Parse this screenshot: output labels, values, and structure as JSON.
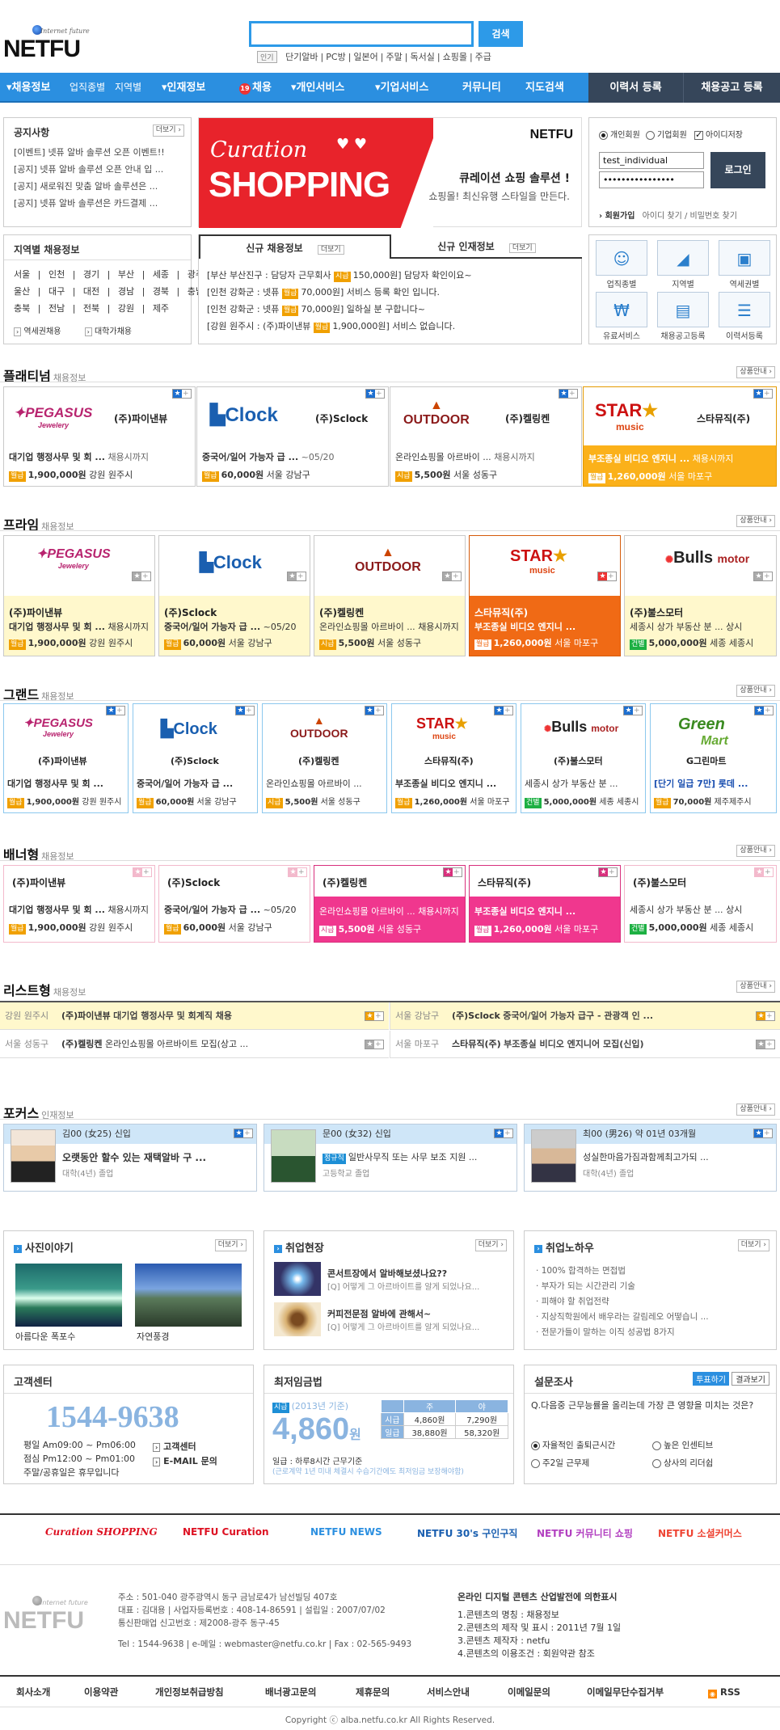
{
  "header": {
    "logo_text": "NETFU",
    "logo_tag": "Internet future",
    "search_button": "검색",
    "quick_badge": "인기",
    "quick_links": [
      "단기알바",
      "PC방",
      "일본어",
      "주말",
      "독서실",
      "쇼핑몰",
      "주급"
    ]
  },
  "nav": {
    "items": [
      "채용정보",
      "업직종별",
      "지역별",
      "인재정보",
      "채용",
      "개인서비스",
      "기업서비스",
      "커뮤니티",
      "지도검색"
    ],
    "resume_btn": "이력서 등록",
    "job_btn": "채용공고 등록"
  },
  "notice": {
    "title": "공지사항",
    "more": "더보기",
    "items": [
      "[이벤트] 넷퓨 알바 솔루션 오픈 이벤트!!",
      "[공지] 넷퓨 알바 솔루션 오픈 안내 입 ...",
      "[공지] 새로워진 맞춤 알바 솔루션은 ...",
      "[공지] 넷퓨 알바 솔루션은 카드결제 ..."
    ]
  },
  "banner": {
    "curation": "Curation",
    "shopping": "SHOPPING",
    "logo": "NETFU",
    "headline": "큐레이션 쇼핑 솔루션 !",
    "sub": "쇼핑몰! 최신유행 스타일을 만든다."
  },
  "login": {
    "personal": "개인회원",
    "company": "기업회원",
    "save_id": "아이디저장",
    "user_id": "test_individual",
    "password": "••••••••••••••••",
    "login_btn": "로그인",
    "join": "회원가입",
    "find": "아이디 찾기 / 비밀번호 찾기"
  },
  "region": {
    "title": "지역별 채용정보",
    "rows": [
      [
        "서울",
        "인천",
        "경기",
        "부산",
        "세종",
        "광주"
      ],
      [
        "울산",
        "대구",
        "대전",
        "경남",
        "경북",
        "충남"
      ],
      [
        "충북",
        "전남",
        "전북",
        "강원",
        "제주"
      ]
    ],
    "station": "역세권채용",
    "univ": "대학가채용"
  },
  "recent": {
    "tab1": "신규 채용정보",
    "tab2": "신규 인재정보",
    "more": "더보기",
    "items": [
      [
        "[부산 부산진구 : 담당자 근무회사",
        "시급",
        "150,000원",
        "] 담당자 확인이요~"
      ],
      [
        "[인천 강화군 : 넷퓨",
        "월급",
        "70,000원",
        "] 서비스 등록 확인 입니다."
      ],
      [
        "[인천 강화군 : 넷퓨",
        "월급",
        "70,000원",
        "] 일하실 분 구합니다~"
      ],
      [
        "[강원 원주시 : (주)파이낸뷰",
        "월급",
        "1,900,000원",
        "] 서비스 없습니다."
      ]
    ]
  },
  "quicklinks": [
    {
      "label": "업직종별",
      "icon": "person-icon"
    },
    {
      "label": "지역별",
      "icon": "map-icon"
    },
    {
      "label": "역세권별",
      "icon": "bus-icon"
    },
    {
      "label": "유료서비스",
      "icon": "won-icon"
    },
    {
      "label": "채용공고등록",
      "icon": "document-icon"
    },
    {
      "label": "이력서등록",
      "icon": "resume-icon"
    }
  ],
  "sections": {
    "platinum": "플래티넘",
    "prime": "프라임",
    "grand": "그랜드",
    "banner": "배너형",
    "list": "리스트형",
    "focus": "포커스",
    "suffix_job": "채용정보",
    "suffix_talent": "인재정보",
    "guide": "상품안내"
  },
  "companies": {
    "pegasus": {
      "logo": "PEGASUS",
      "logo_sub": "Jewelery",
      "name": "(주)파이낸뷰",
      "title": "대기업 행정사무 및 회 ...",
      "deadline": "채용시까지",
      "wage_type": "월급",
      "wage": "1,900,000원",
      "loc": "강원 원주시"
    },
    "clock": {
      "logo": "Clock",
      "logo_sub": "outdoor wear",
      "name": "(주)Sclock",
      "title": "중국어/일어 가능자 급 ...",
      "deadline": "~05/20",
      "wage_type": "월급",
      "wage": "60,000원",
      "loc": "서울 강남구"
    },
    "outdoor": {
      "logo": "OUTDOOR",
      "logo_sub": "outdoor sport",
      "name": "(주)켈링켄",
      "title": "온라인쇼핑몰 아르바이 ...",
      "deadline": "채용시까지",
      "wage_type": "시급",
      "wage": "5,500원",
      "loc": "서울 성동구"
    },
    "star": {
      "logo": "STAR",
      "logo_sub": "music",
      "name": "스타뮤직(주)",
      "title": "부조종실 비디오 엔지니 ...",
      "deadline": "채용시까지",
      "wage_type": "월급",
      "wage": "1,260,000원",
      "loc": "서울 마포구"
    },
    "bulls": {
      "logo": "Bulls",
      "logo_sub": "motor",
      "name": "(주)불스모터",
      "title": "세종시 상가 부동산 분 ...",
      "deadline": "상시",
      "wage_type": "건별",
      "wage": "5,000,000원",
      "loc": "세종 세종시"
    },
    "green": {
      "logo": "Green",
      "logo_sub": "Mart",
      "name": "G그린마트",
      "title": "[단기 일급 7만] 롯데 ...",
      "wage_type": "월급",
      "wage": "70,000원",
      "loc": "제주제주시"
    }
  },
  "listrows": [
    {
      "loc": "강원 원주시",
      "name": "(주)파이낸뷰",
      "title": "대기업 행정사무 및 회계직 채용"
    },
    {
      "loc": "서울 강남구",
      "name": "(주)Sclock",
      "title": "중국어/일어 가능자 급구 - 관광객 인 ..."
    },
    {
      "loc": "서울 성동구",
      "name": "(주)켈링켄",
      "title": "온라인쇼핑몰 아르바이트 모집(상고 ..."
    },
    {
      "loc": "서울 마포구",
      "name": "스타뮤직(주)",
      "title": "부조종실 비디오 엔지니어 모집(신입)"
    }
  ],
  "focus": [
    {
      "head": "김00 (女25) 신입",
      "title": "오랫동안 할수 있는 재택알바 구 ...",
      "edu": "대학(4년) 졸업"
    },
    {
      "head": "문00 (女32) 신입",
      "badge": "정규직",
      "title": "일반사무직 또는 사무 보조 지원 ...",
      "edu": "고등학교 졸업"
    },
    {
      "head": "최00 (男26) 약 01년 03개월",
      "title": "성실한마음가짐과함께최고가되 ...",
      "edu": "대학(4년) 졸업"
    }
  ],
  "photo": {
    "title": "사진이야기",
    "more": "더보기",
    "items": [
      "아름다운 폭포수",
      "자연풍경"
    ]
  },
  "field": {
    "title": "취업현장",
    "more": "더보기",
    "items": [
      {
        "t": "콘서트장에서 알바해보셨나요??",
        "s": "[Q] 어떻게 그 아르바이트를 알게 되었나요..."
      },
      {
        "t": "커피전문점 알바에 관해서~",
        "s": "[Q] 어떻게 그 아르바이트를 알게 되었나요..."
      }
    ]
  },
  "knowhow": {
    "title": "취업노하우",
    "more": "더보기",
    "items": [
      "100% 합격하는 면접법",
      "부자가 되는 시간관리 기술",
      "피해야 할 취업전략",
      "지상직학원에서 배우라는 갈림레오 어떻습니 ...",
      "전문가들이 말하는 이직 성공법 8가지"
    ]
  },
  "cs": {
    "title": "고객센터",
    "phone": "1544-9638",
    "hours": [
      "평일 Am09:00 ~ Pm06:00",
      "점심 Pm12:00 ~ Pm01:00",
      "주말/공휴일은 휴무입니다"
    ],
    "center": "고객센터",
    "email": "E-MAIL 문의"
  },
  "minwage": {
    "title": "최저임금법",
    "year_badge": "시급",
    "year": "(2013년 기준)",
    "amount": "4,860",
    "unit": "원",
    "note": "일급 : 하루8시간 근무기준",
    "sub": "(근로계약 1년 미내 체결시 수습기간에도 최저임금 보장해야함)",
    "col_week": "주",
    "col_night": "야",
    "row1": "시급",
    "row2": "일급",
    "v": [
      [
        "4,860원",
        "7,290원"
      ],
      [
        "38,880원",
        "58,320원"
      ]
    ]
  },
  "poll": {
    "title": "설문조사",
    "vote": "투표하기",
    "result": "결과보기",
    "q": "Q.다음중 근무능률을 올리는데 가장 큰 영향을 미치는 것은?",
    "opts": [
      "자율적인 출퇴근시간",
      "높은 인센티브",
      "주2일 근무제",
      "상사의 리더쉽"
    ]
  },
  "brands": [
    "Curation SHOPPING",
    "NETFU Curation",
    "NETFU NEWS",
    "NETFU 30's 구인구직",
    "NETFU 커뮤니티 쇼핑",
    "NETFU 소셜커머스"
  ],
  "footer": {
    "addr": "주소 : 501-040 광주광역시 동구 금남로4가 남선빌딩 407호",
    "ceo": "대표 : 김대용 | 사업자등록번호 : 408-14-86591 | 설립일 : 2007/07/02",
    "reg": "통신판매업 신고번호 : 제2008-광주 동구-45",
    "tel": "Tel : 1544-9638 | e-메일 : webmaster@netfu.co.kr | Fax : 02-565-9493",
    "law_title": "온라인 디지털 콘텐츠 산업발전에 의한표시",
    "law": [
      "1.콘텐츠의 명칭 : 채용정보",
      "2.콘텐츠의 제작 및 표시 : 2011년 7월 1일",
      "3.콘텐츠 제작자 : netfu",
      "4.콘텐츠의 이용조건 : 회원약관 참조"
    ],
    "links": [
      "회사소개",
      "이용약관",
      "개인정보취급방침",
      "배너광고문의",
      "제휴문의",
      "서비스안내",
      "이메일문의",
      "이메일무단수집거부",
      "RSS"
    ],
    "copy": "Copyright ⓒ alba.netfu.co.kr All Rights Reserved."
  }
}
